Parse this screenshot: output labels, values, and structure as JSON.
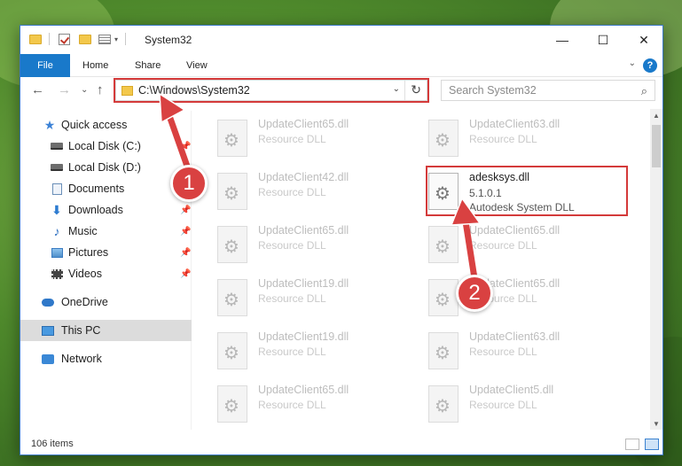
{
  "window": {
    "title": "System32",
    "minimize_glyph": "—",
    "maximize_glyph": "☐",
    "close_glyph": "✕"
  },
  "ribbon": {
    "tabs": [
      "File",
      "Home",
      "Share",
      "View"
    ],
    "help_glyph": "?",
    "expand_glyph": "⌄"
  },
  "nav": {
    "back_glyph": "←",
    "forward_glyph": "→",
    "recent_glyph": "⌄",
    "up_glyph": "↑",
    "address": "C:\\Windows\\System32",
    "address_dropdown_glyph": "⌄",
    "refresh_glyph": "↻",
    "search_placeholder": "Search System32",
    "search_glyph": "⌕"
  },
  "sidebar": {
    "items": [
      {
        "label": "Quick access",
        "icon": "star-icon"
      },
      {
        "label": "Local Disk (C:)",
        "icon": "drive-icon",
        "pinned": true
      },
      {
        "label": "Local Disk (D:)",
        "icon": "drive-icon"
      },
      {
        "label": "Documents",
        "icon": "documents-icon",
        "pinned": true
      },
      {
        "label": "Downloads",
        "icon": "downloads-icon",
        "pinned": true
      },
      {
        "label": "Music",
        "icon": "music-icon",
        "pinned": true
      },
      {
        "label": "Pictures",
        "icon": "pictures-icon",
        "pinned": true
      },
      {
        "label": "Videos",
        "icon": "videos-icon",
        "pinned": true
      },
      {
        "label": "OneDrive",
        "icon": "onedrive-icon"
      },
      {
        "label": "This PC",
        "icon": "this-pc-icon",
        "selected": true
      },
      {
        "label": "Network",
        "icon": "network-icon"
      }
    ],
    "pin_glyph": "📌"
  },
  "files": [
    {
      "name": "UpdateClient65.dll",
      "type": "Resource DLL"
    },
    {
      "name": "UpdateClient63.dll",
      "type": "Resource DLL"
    },
    {
      "name": "UpdateClient42.dll",
      "type": "Resource DLL"
    },
    {
      "name": "adesksys.dll",
      "version": "5.1.0.1",
      "description": "Autodesk System DLL",
      "active": true
    },
    {
      "name": "UpdateClient65.dll",
      "type": "Resource DLL"
    },
    {
      "name": "UpdateClient65.dll",
      "type": "Resource DLL"
    },
    {
      "name": "UpdateClient19.dll",
      "type": "Resource DLL"
    },
    {
      "name": "UpdateClient65.dll",
      "type": "Resource DLL"
    },
    {
      "name": "UpdateClient19.dll",
      "type": "Resource DLL"
    },
    {
      "name": "UpdateClient63.dll",
      "type": "Resource DLL"
    },
    {
      "name": "UpdateClient65.dll",
      "type": "Resource DLL"
    },
    {
      "name": "UpdateClient5.dll",
      "type": "Resource DLL"
    }
  ],
  "status": {
    "items_count": "106 items"
  },
  "callouts": {
    "step1": "1",
    "step2": "2",
    "color": "#d94141"
  },
  "colors": {
    "accent": "#1979ca",
    "highlight": "#d43a3a"
  }
}
